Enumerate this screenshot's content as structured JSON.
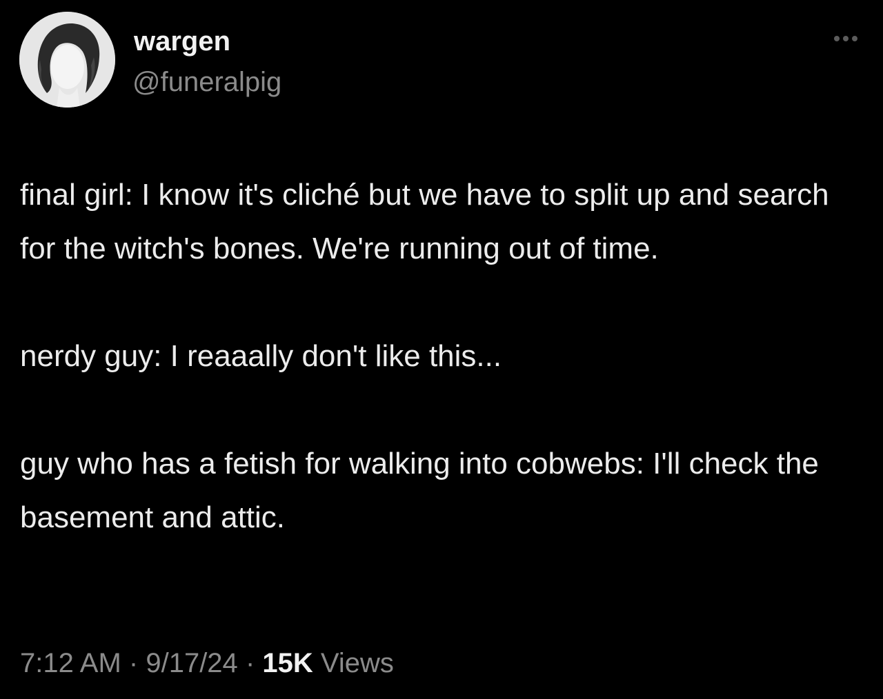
{
  "author": {
    "display_name": "wargen",
    "handle": "@funeralpig",
    "avatar_icon": "profile-photo"
  },
  "more_icon": "more-horizontal-icon",
  "tweet": {
    "paragraphs": [
      "final girl: I know it's cliché but we have to split up and search for the witch's bones. We're running out of time.",
      "nerdy guy: I reaaally don't like this...",
      "guy who has a fetish for walking into cobwebs: I'll check the basement and attic."
    ]
  },
  "meta": {
    "time": "7:12 AM",
    "separator": "·",
    "date": "9/17/24",
    "views_count": "15K",
    "views_label": "Views"
  },
  "colors": {
    "background": "#000000",
    "primary_text": "#ececec",
    "secondary_text": "#8b8b8b"
  }
}
